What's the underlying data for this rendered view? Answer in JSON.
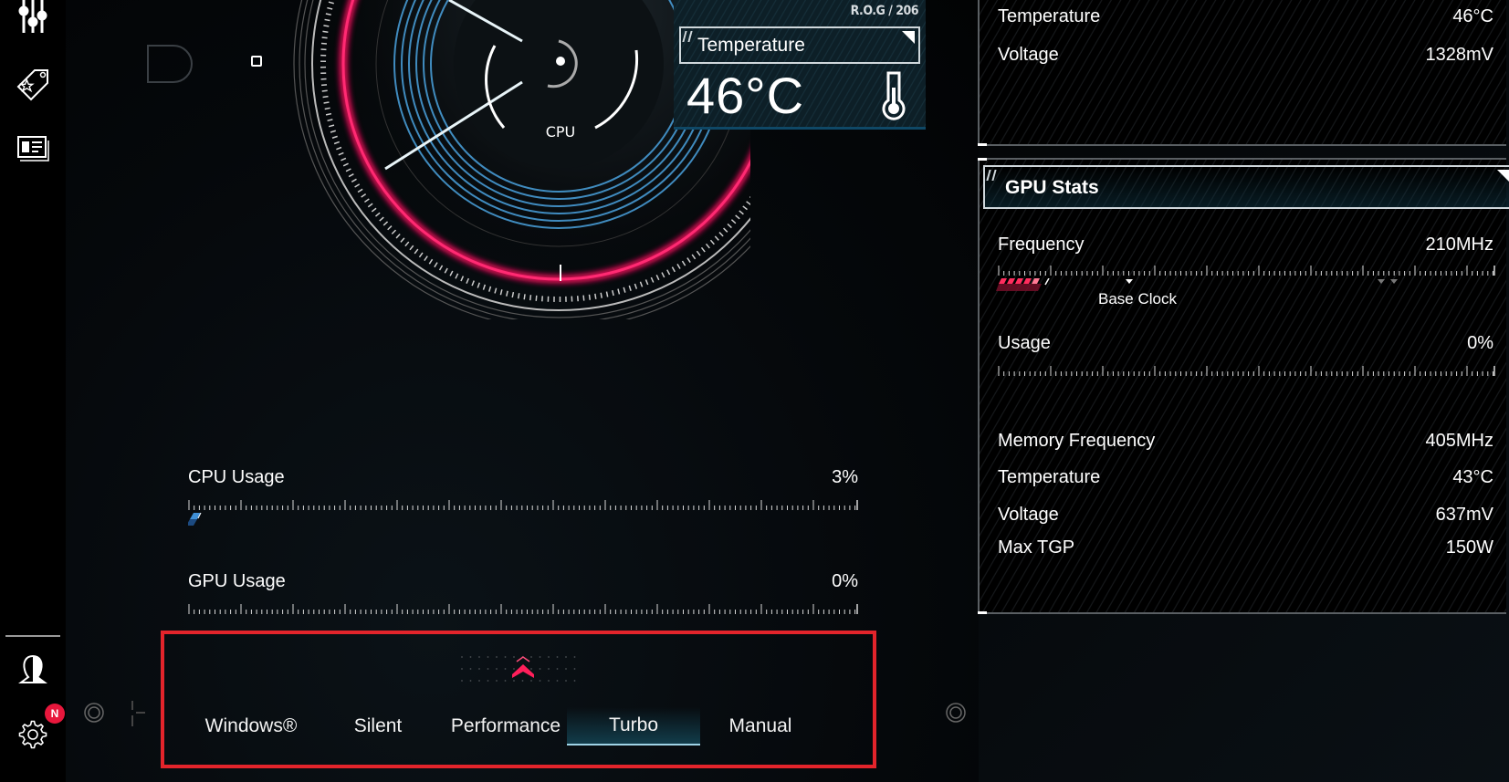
{
  "sidebar": {
    "items": [
      {
        "name": "sliders-icon",
        "label": "System Configuration"
      },
      {
        "name": "tag-star-icon",
        "label": "Deals"
      },
      {
        "name": "news-card-icon",
        "label": "News"
      }
    ],
    "bottom": [
      {
        "name": "user-profile-icon"
      },
      {
        "name": "gear-icon"
      }
    ],
    "notification_badge": "N"
  },
  "gauge": {
    "label": "CPU"
  },
  "temperature_card": {
    "brand_tag": "R.O.G / 206",
    "label": "Temperature",
    "value": "46°C"
  },
  "usage": {
    "cpu": {
      "label": "CPU Usage",
      "value": "3%",
      "percent": 3
    },
    "gpu": {
      "label": "GPU Usage",
      "value": "0%",
      "percent": 0
    }
  },
  "modes": {
    "items": [
      "Windows®",
      "Silent",
      "Performance",
      "Turbo",
      "Manual"
    ],
    "active": "Turbo"
  },
  "cpu_stats": {
    "rows": [
      {
        "label": "Temperature",
        "value": "46°C"
      },
      {
        "label": "Voltage",
        "value": "1328mV"
      }
    ]
  },
  "gpu_stats": {
    "title": "GPU Stats",
    "frequency": {
      "label": "Frequency",
      "value": "210MHz",
      "fill_fraction": 0.1
    },
    "base_clock_label": "Base Clock",
    "usage": {
      "label": "Usage",
      "value": "0%",
      "percent": 0
    },
    "rows": [
      {
        "label": "Memory Frequency",
        "value": "405MHz"
      },
      {
        "label": "Temperature",
        "value": "43°C"
      },
      {
        "label": "Voltage",
        "value": "637mV"
      },
      {
        "label": "Max TGP",
        "value": "150W"
      }
    ]
  },
  "colors": {
    "accent_red": "#e8173c",
    "highlight_border": "#e3242b",
    "cpu_blue": "#3f8fd6",
    "active_tab": "#123c4a"
  }
}
